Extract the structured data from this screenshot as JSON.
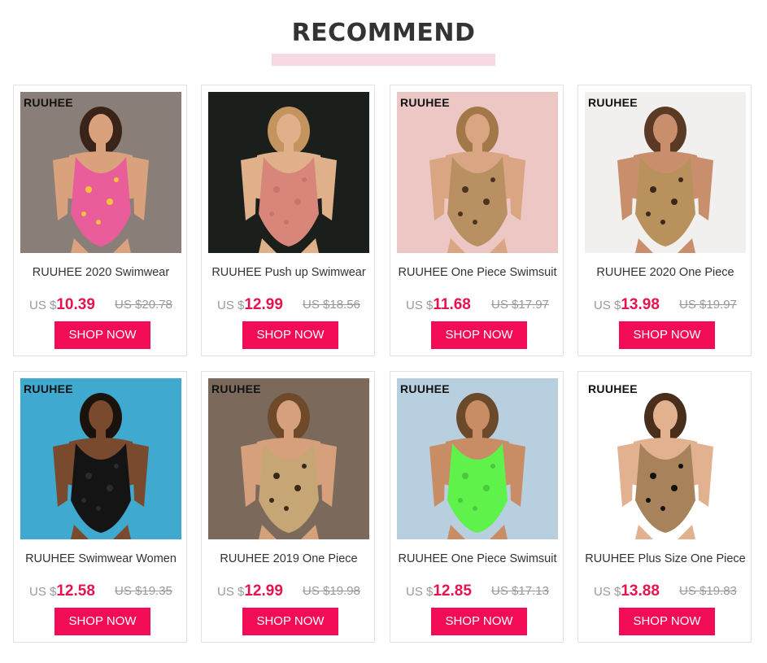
{
  "section": {
    "title": "RECOMMEND"
  },
  "products": [
    {
      "brand": "RUUHEE",
      "title": "RUUHEE 2020 Swimwear",
      "currency": "US $",
      "price": "10.39",
      "old_price": "US $20.78",
      "cta": "SHOP NOW",
      "photo_desc": "floral-print one-piece swimsuit",
      "colors": {
        "bg": "#8a7f78",
        "suit": "#e85d9a",
        "accent": "#f6c23b",
        "skin": "#d9a27d",
        "hair": "#3a241a"
      }
    },
    {
      "brand": "",
      "title": "RUUHEE Push up Swimwear",
      "currency": "US $",
      "price": "12.99",
      "old_price": "US $18.56",
      "cta": "SHOP NOW",
      "photo_desc": "pink one-piece swimsuit",
      "colors": {
        "bg": "#1b1f1c",
        "suit": "#d9867a",
        "accent": "#c9736a",
        "skin": "#e0b08a",
        "hair": "#c4945e"
      }
    },
    {
      "brand": "RUUHEE",
      "title": "RUUHEE One Piece Swimsuit",
      "currency": "US $",
      "price": "11.68",
      "old_price": "US $17.97",
      "cta": "SHOP NOW",
      "photo_desc": "leopard tie-front swimsuit",
      "colors": {
        "bg": "#ecc7c4",
        "suit": "#b89062",
        "accent": "#4a3320",
        "skin": "#d9a582",
        "hair": "#a27848"
      }
    },
    {
      "brand": "RUUHEE",
      "title": "RUUHEE 2020 One Piece",
      "currency": "US $",
      "price": "13.98",
      "old_price": "US $19.97",
      "cta": "SHOP NOW",
      "photo_desc": "leopard one-piece swimsuit",
      "colors": {
        "bg": "#f2f0ee",
        "suit": "#b8915c",
        "accent": "#3b2818",
        "skin": "#c98f6c",
        "hair": "#5a3a24"
      }
    },
    {
      "brand": "RUUHEE",
      "title": "RUUHEE Swimwear Women",
      "currency": "US $",
      "price": "12.58",
      "old_price": "US $19.35",
      "cta": "SHOP NOW",
      "photo_desc": "black lace cut-out swimsuit",
      "colors": {
        "bg": "#3fa9cf",
        "suit": "#141414",
        "accent": "#2b2b2b",
        "skin": "#7a4a2e",
        "hair": "#1a120c"
      }
    },
    {
      "brand": "RUUHEE",
      "title": "RUUHEE 2019 One Piece",
      "currency": "US $",
      "price": "12.99",
      "old_price": "US $19.98",
      "cta": "SHOP NOW",
      "photo_desc": "leopard v-neck swimsuit",
      "colors": {
        "bg": "#7b6a5c",
        "suit": "#c7a675",
        "accent": "#3b2818",
        "skin": "#d7a07c",
        "hair": "#6e4a2a"
      }
    },
    {
      "brand": "RUUHEE",
      "title": "RUUHEE One Piece Swimsuit",
      "currency": "US $",
      "price": "12.85",
      "old_price": "US $17.13",
      "cta": "SHOP NOW",
      "photo_desc": "neon green bikini",
      "colors": {
        "bg": "#b7cfdf",
        "suit": "#5ef24a",
        "accent": "#49c93b",
        "skin": "#c98d66",
        "hair": "#6b4a2b"
      }
    },
    {
      "brand": "RUUHEE",
      "title": "RUUHEE Plus Size One Piece",
      "currency": "US $",
      "price": "13.88",
      "old_price": "US $19.83",
      "cta": "SHOP NOW",
      "photo_desc": "leopard top black bottom swimsuit",
      "colors": {
        "bg": "#ffffff",
        "suit": "#a7825a",
        "accent": "#111111",
        "skin": "#e2b290",
        "hair": "#4a2e1c"
      }
    }
  ],
  "colors": {
    "accent": "#f20c55",
    "price": "#e6134f",
    "heading": "#333333",
    "heading_bar": "#f6d9e3"
  }
}
